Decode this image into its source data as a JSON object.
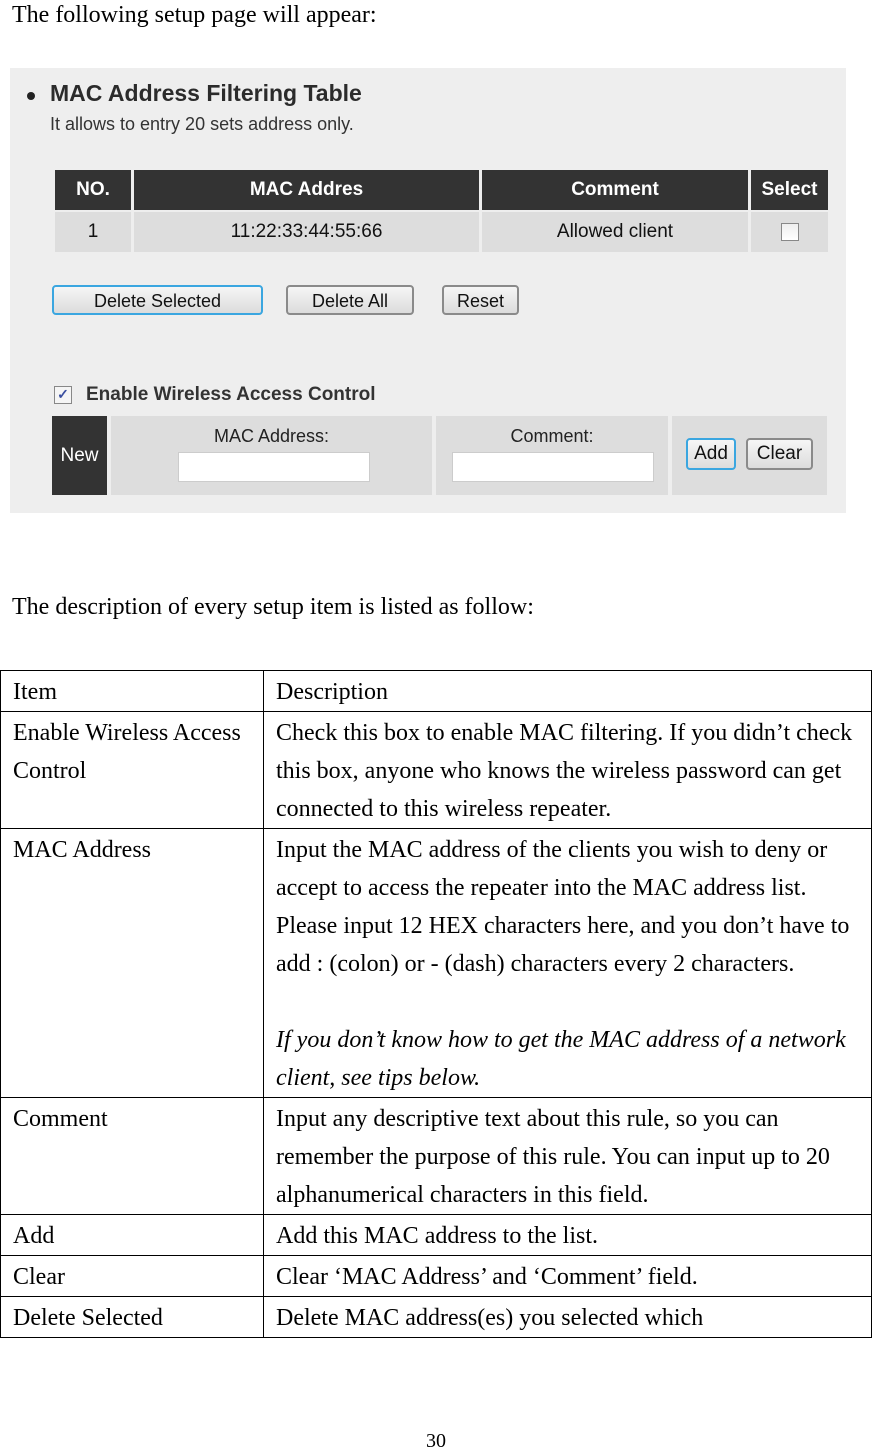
{
  "intro_text": "The following setup page will appear:",
  "panel": {
    "title": "MAC Address Filtering Table",
    "subtitle": "It allows to entry 20 sets address only.",
    "table": {
      "headers": [
        "NO.",
        "MAC Addres",
        "Comment",
        "Select"
      ],
      "rows": [
        {
          "no": "1",
          "mac": "11:22:33:44:55:66",
          "comment": "Allowed client",
          "selected": false
        }
      ]
    },
    "buttons": {
      "delete_selected": "Delete Selected",
      "delete_all": "Delete All",
      "reset": "Reset"
    },
    "enable_label": "Enable Wireless Access Control",
    "enable_checked": true,
    "new_row": {
      "label": "New",
      "mac_label": "MAC Address:",
      "mac_value": "",
      "comment_label": "Comment:",
      "comment_value": "",
      "add": "Add",
      "clear": "Clear"
    }
  },
  "description_intro": "The description of every setup item is listed as follow:",
  "description_table": {
    "headers": [
      "Item",
      "Description"
    ],
    "rows": [
      {
        "item": "Enable Wireless Access Control",
        "desc": "Check this box to enable MAC filtering. If you didn’t check this box, anyone who knows the wireless password can get connected to this wireless repeater."
      },
      {
        "item": "MAC Address",
        "desc": "Input the MAC address of the clients you wish to deny or accept to access the repeater into the MAC address list. Please input 12 HEX characters here, and you don’t have to add : (colon) or - (dash) characters every 2 characters.",
        "note": "If you don’t know how to get the MAC address of a network client, see tips below."
      },
      {
        "item": "Comment",
        "desc": "Input any descriptive text about this rule, so you can remember the purpose of this rule. You can input up to 20 alphanumerical characters in this field."
      },
      {
        "item": "Add",
        "desc": "Add this MAC address to the list."
      },
      {
        "item": "Clear",
        "desc": "Clear ‘MAC Address’ and ‘Comment’ field."
      },
      {
        "item": "Delete Selected",
        "desc": "Delete MAC address(es) you selected which"
      }
    ]
  },
  "page_number": "30"
}
